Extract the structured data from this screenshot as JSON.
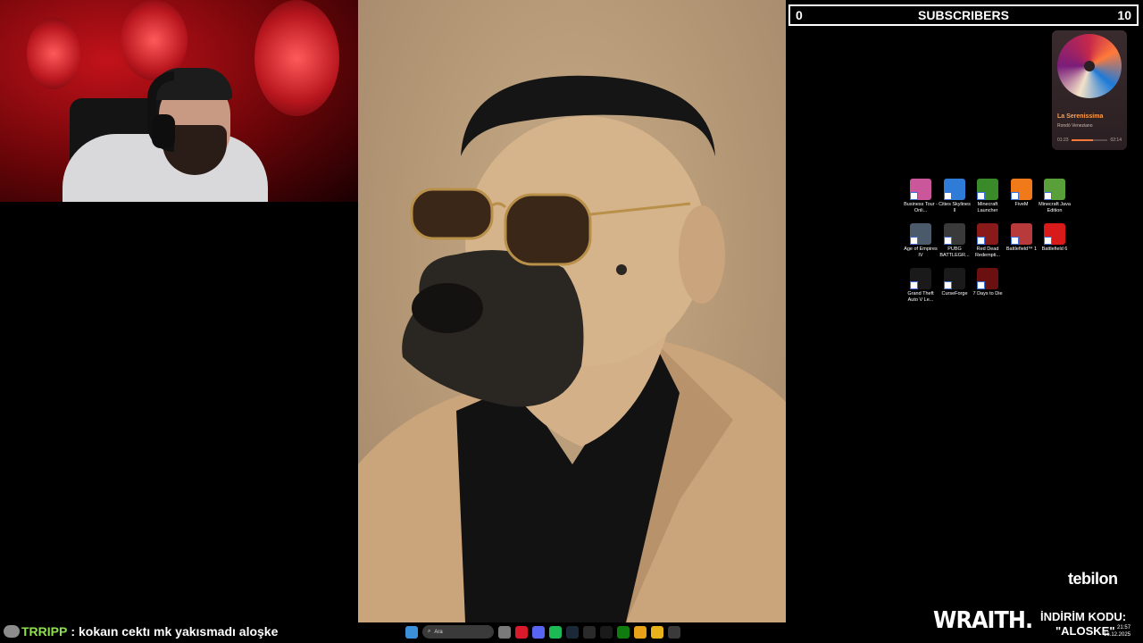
{
  "subscribers": {
    "current": "0",
    "title": "SUBSCRIBERS",
    "goal": "10"
  },
  "music": {
    "title": "La Serenissima",
    "artist": "Rondò Veneziano",
    "elapsed": "01:23",
    "duration": "02:14",
    "progress": 0.6
  },
  "desktop_icons": [
    {
      "label": "Business Tour - Onli...",
      "icon": "business-tour-icon",
      "color": "#c9579a"
    },
    {
      "label": "Cities Skylines II",
      "icon": "cities-skylines-icon",
      "color": "#2f7bd8"
    },
    {
      "label": "Minecraft Launcher",
      "icon": "minecraft-launcher-icon",
      "color": "#3b8a2a"
    },
    {
      "label": "FiveM",
      "icon": "fivem-icon",
      "color": "#f07a1a"
    },
    {
      "label": "Minecraft Java Edition",
      "icon": "minecraft-java-icon",
      "color": "#5aa03a"
    },
    {
      "label": "Age of Empires IV",
      "icon": "age-of-empires-icon",
      "color": "#4a5a6a"
    },
    {
      "label": "PUBG BATTLEGR...",
      "icon": "pubg-icon",
      "color": "#3a3a3a"
    },
    {
      "label": "Red Dead Redempti...",
      "icon": "red-dead-icon",
      "color": "#8a1a1a"
    },
    {
      "label": "Battlefield™ 1",
      "icon": "battlefield-1-icon",
      "color": "#b83a3a"
    },
    {
      "label": "Battlefield 6",
      "icon": "battlefield-6-icon",
      "color": "#d81a1a"
    },
    {
      "label": "Grand Theft Auto V Le...",
      "icon": "gta-v-icon",
      "color": "#1a1a1a"
    },
    {
      "label": "CurseForge",
      "icon": "curseforge-icon",
      "color": "#1a1a1a"
    },
    {
      "label": "7 Days to Die",
      "icon": "7-days-to-die-icon",
      "color": "#6a1010"
    }
  ],
  "brand": {
    "sponsor": "tebilon",
    "wraith": "WRAITH.",
    "promo_label": "İNDİRİM KODU:",
    "promo_code": "\"ALOSKE\""
  },
  "chat": {
    "user": "TRRIPP",
    "separator": ":",
    "message": "kokaın cektı mk yakısmadı aloşke"
  },
  "taskbar": {
    "search_placeholder": "Ara",
    "icons": [
      {
        "name": "start-icon",
        "color": "#3b8ed8"
      },
      {
        "name": "task-view-icon",
        "color": "#7a7a7a"
      },
      {
        "name": "opera-icon",
        "color": "#d81a2a"
      },
      {
        "name": "discord-icon",
        "color": "#5865f2"
      },
      {
        "name": "spotify-icon",
        "color": "#1db954"
      },
      {
        "name": "steam-icon",
        "color": "#1b2838"
      },
      {
        "name": "epic-games-icon",
        "color": "#2a2a2a"
      },
      {
        "name": "capcut-icon",
        "color": "#1a1a1a"
      },
      {
        "name": "xbox-icon",
        "color": "#107c10"
      },
      {
        "name": "chrome-icon",
        "color": "#e8a21a"
      },
      {
        "name": "file-explorer-icon",
        "color": "#e8b21a"
      },
      {
        "name": "obs-icon",
        "color": "#3a3a3a"
      }
    ],
    "time": "21:57",
    "date": "16.12.2025"
  }
}
